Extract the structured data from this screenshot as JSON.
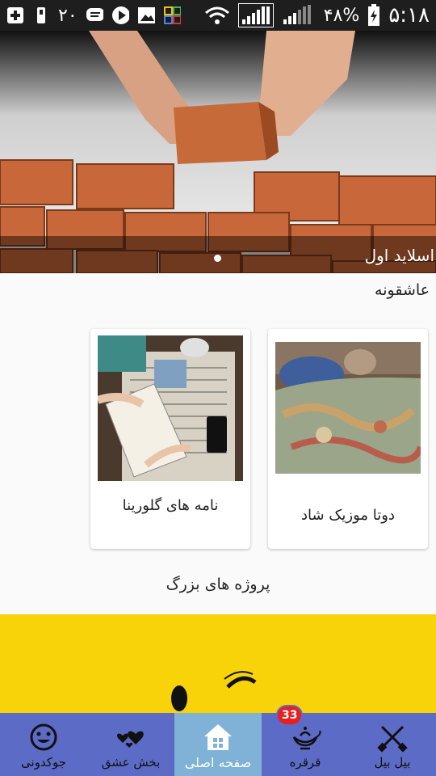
{
  "status_bar": {
    "notification_count": "۲۰",
    "battery": "۴۸%",
    "time": "۵:۱۸"
  },
  "slider": {
    "caption": "اسلاید اول"
  },
  "sections": {
    "romantic": {
      "title": "عاشقونه",
      "cards": [
        {
          "title": "دوتا موزیک شاد"
        },
        {
          "title": "نامه های گلورینا"
        }
      ]
    },
    "big_projects": {
      "title": "پروژه های بزرگ"
    }
  },
  "bottom_nav": {
    "items": [
      {
        "label": "جوکدونی",
        "icon": "smiley-icon"
      },
      {
        "label": "بخش عشق",
        "icon": "hearts-icon"
      },
      {
        "label": "صفحه اصلی",
        "icon": "home-icon",
        "active": true
      },
      {
        "label": "قرقره",
        "icon": "lamp-icon",
        "badge": "33"
      },
      {
        "label": "بیل بیل",
        "icon": "shovels-icon"
      }
    ]
  },
  "colors": {
    "nav_bg": "#5b6bc6",
    "nav_active": "#7fb2d6",
    "banner": "#f8d30a",
    "badge": "#e91e1e"
  }
}
